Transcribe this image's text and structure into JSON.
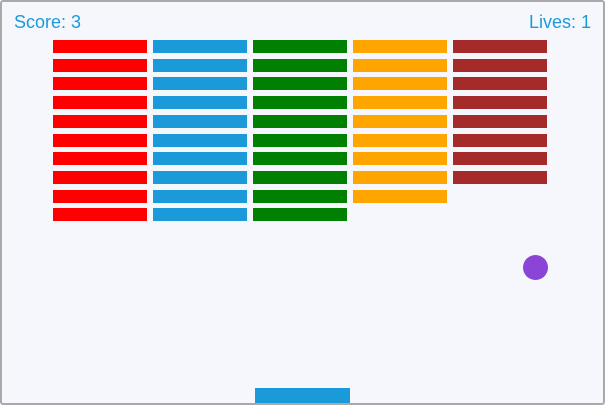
{
  "hud": {
    "score_text": "Score: 3",
    "lives_text": "Lives: 1"
  },
  "colors": {
    "background": "#f6f7fd",
    "hud_text": "#1a9ad9",
    "ball": "#8a44d6",
    "paddle": "#1a9ad9"
  },
  "bricks": {
    "columns": [
      {
        "color": "#ff0000",
        "remaining": 10
      },
      {
        "color": "#1a9ad9",
        "remaining": 10
      },
      {
        "color": "#008000",
        "remaining": 10
      },
      {
        "color": "#ffa500",
        "remaining": 9
      },
      {
        "color": "#a52a2a",
        "remaining": 8
      }
    ],
    "rows_per_column": 10
  }
}
